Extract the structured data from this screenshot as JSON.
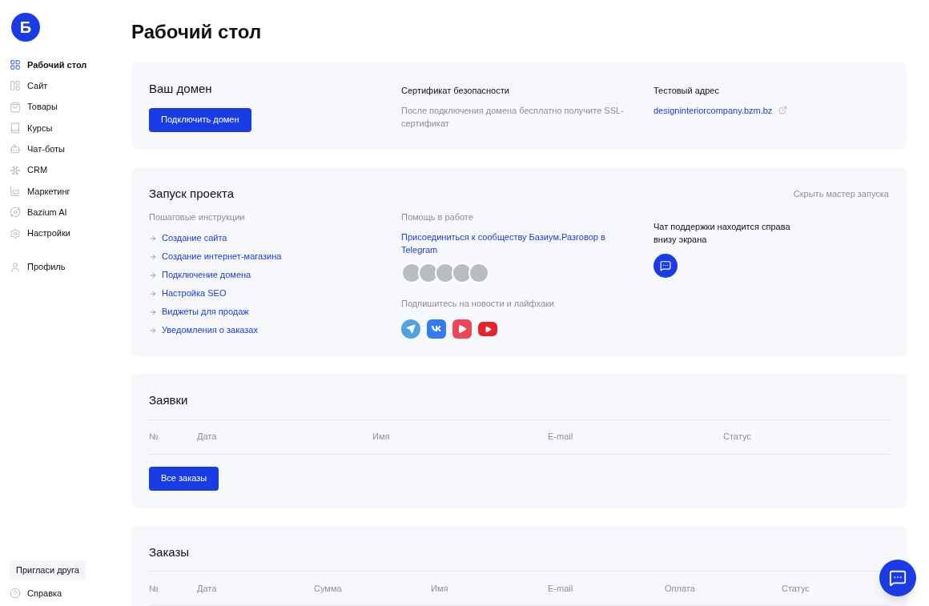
{
  "logo": {
    "letter": "Б"
  },
  "sidebar": {
    "items": [
      {
        "label": "Рабочий стол",
        "kind": "grid",
        "selected": true
      },
      {
        "label": "Сайт",
        "kind": "layout",
        "selected": false
      },
      {
        "label": "Товары",
        "kind": "bag",
        "selected": false
      },
      {
        "label": "Курсы",
        "kind": "book",
        "selected": false
      },
      {
        "label": "Чат-боты",
        "kind": "bot",
        "selected": false
      },
      {
        "label": "CRM",
        "kind": "crm",
        "selected": false
      },
      {
        "label": "Маркетинг",
        "kind": "chart",
        "selected": false
      },
      {
        "label": "Bazium AI",
        "kind": "ai",
        "selected": false
      },
      {
        "label": "Настройки",
        "kind": "settings",
        "selected": false
      }
    ],
    "profile": "Профиль",
    "invite": "Пригласи друга",
    "help": "Справка"
  },
  "page_title": "Рабочий стол",
  "domain": {
    "title": "Ваш домен",
    "button": "Подключить домен",
    "cert_title": "Сертификат безопасности",
    "cert_text": "После подключения домена бесплатно получите SSL-сертификат",
    "test_title": "Тестовый адрес",
    "test_link": "designinteriorcompany.bzm.bz"
  },
  "launch": {
    "title": "Запуск проекта",
    "hide": "Скрыть мастер запуска",
    "steps_title": "Пошаговые инструкции",
    "steps": [
      "Создание сайта",
      "Создание интернет-магазина",
      "Подключение домена",
      "Настройка SEO",
      "Виджеты для продаж",
      "Уведомления о заказах"
    ],
    "help_title": "Помощь в работе",
    "community_link": "Присоединиться к сообществу Базиум.Разговор в Telegram",
    "subscribe": "Подпишитесь на новости и лайфхаки",
    "socials": [
      {
        "kind": "telegram",
        "color": "#4fa3e0"
      },
      {
        "kind": "vk",
        "color": "#2f7cf6"
      },
      {
        "kind": "rutube",
        "color": "#ee4655"
      },
      {
        "kind": "youtube",
        "color": "#e6232a"
      }
    ],
    "support_text": "Чат поддержки находится справа внизу экрана"
  },
  "requests": {
    "title": "Заявки",
    "columns": [
      "№",
      "Дата",
      "Имя",
      "E-mail",
      "Статус"
    ],
    "button": "Все заказы"
  },
  "orders": {
    "title": "Заказы",
    "columns": [
      "№",
      "Дата",
      "Сумма",
      "Имя",
      "E-mail",
      "Оплата",
      "Статус"
    ]
  }
}
